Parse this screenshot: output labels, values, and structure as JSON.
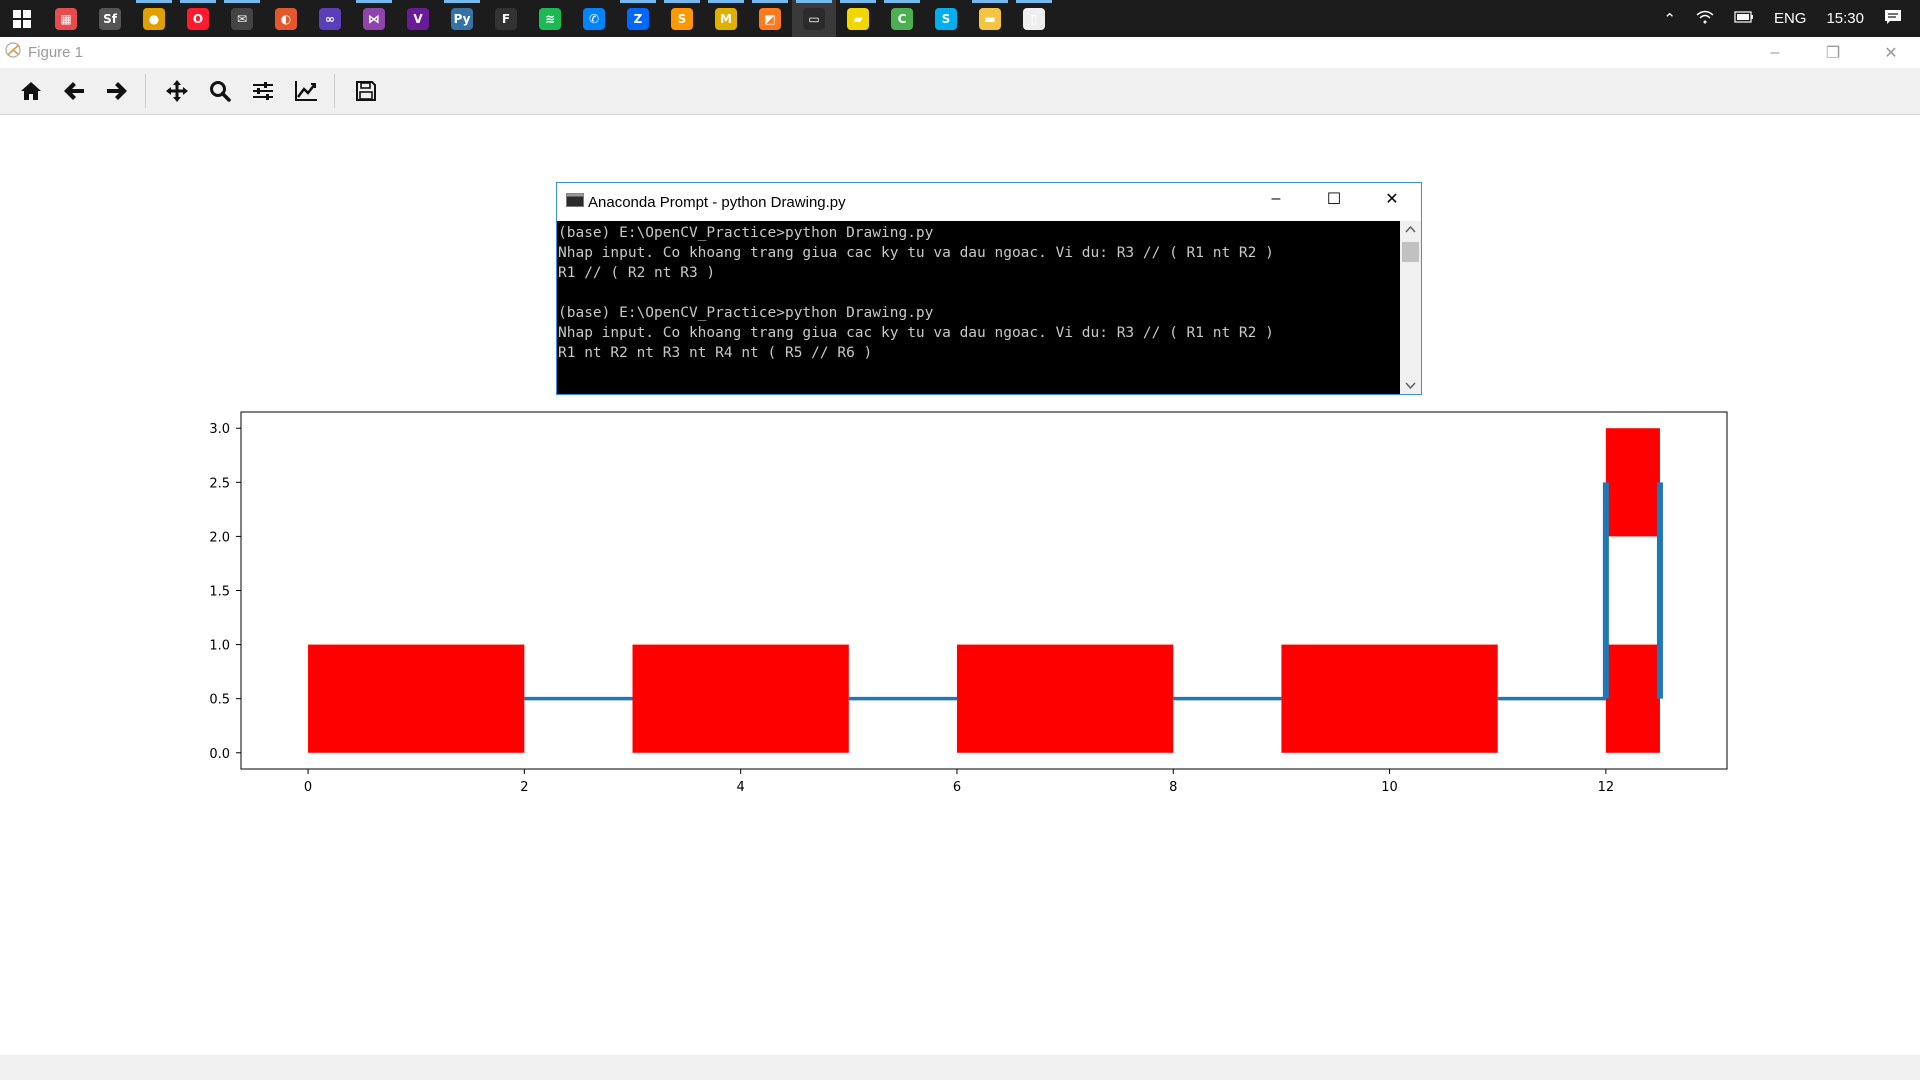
{
  "taskbar": {
    "apps": [
      {
        "name": "windows-start-icon",
        "glyph": "",
        "color": "#ffffff"
      },
      {
        "name": "app-grid-icon",
        "glyph": "▦",
        "color": "#e84b4b"
      },
      {
        "name": "sf-app-icon",
        "glyph": "Sf",
        "color": "#555555"
      },
      {
        "name": "chrome-icon",
        "glyph": "●",
        "color": "#e0a100"
      },
      {
        "name": "opera-icon",
        "glyph": "O",
        "color": "#ff1b2d"
      },
      {
        "name": "mail-icon",
        "glyph": "✉",
        "color": "#444444"
      },
      {
        "name": "paint-app-icon",
        "glyph": "◐",
        "color": "#e2582b"
      },
      {
        "name": "infinity-app-icon",
        "glyph": "∞",
        "color": "#5b3fb8"
      },
      {
        "name": "visual-studio-icon",
        "glyph": "⋈",
        "color": "#8e44ad"
      },
      {
        "name": "visual-studio-2-icon",
        "glyph": "V",
        "color": "#6a1b9a"
      },
      {
        "name": "python-icon",
        "glyph": "Py",
        "color": "#3572a5"
      },
      {
        "name": "fl-studio-icon",
        "glyph": "F",
        "color": "#333333"
      },
      {
        "name": "spotify-icon",
        "glyph": "≋",
        "color": "#1db954"
      },
      {
        "name": "messenger-icon",
        "glyph": "✆",
        "color": "#0084ff"
      },
      {
        "name": "zalo-icon",
        "glyph": "Z",
        "color": "#0068ff"
      },
      {
        "name": "sublime-text-icon",
        "glyph": "S",
        "color": "#ff9800"
      },
      {
        "name": "matlab-icon",
        "glyph": "M",
        "color": "#e0b000"
      },
      {
        "name": "orange-app-icon",
        "glyph": "◩",
        "color": "#ff7a1a"
      },
      {
        "name": "terminal-icon",
        "glyph": "▭",
        "color": "#2b2b2b"
      },
      {
        "name": "sticky-notes-icon",
        "glyph": "▰",
        "color": "#f2d600"
      },
      {
        "name": "camtasia-icon",
        "glyph": "C",
        "color": "#4caf50"
      },
      {
        "name": "skype-icon",
        "glyph": "S",
        "color": "#00aff0"
      },
      {
        "name": "file-explorer-icon",
        "glyph": "▬",
        "color": "#f4c542"
      },
      {
        "name": "notepad-icon",
        "glyph": "▯",
        "color": "#eeeeee"
      }
    ],
    "running": [
      3,
      4,
      5,
      8,
      10,
      14,
      15,
      16,
      17,
      18,
      19,
      20,
      22,
      23
    ],
    "active": 18,
    "tray": {
      "language": "ENG",
      "time": "15:30"
    }
  },
  "figure_window": {
    "title": "Figure 1",
    "controls": [
      "–",
      "❐",
      "✕"
    ]
  },
  "toolbar": {
    "buttons": [
      {
        "name": "home-icon",
        "label": "Home"
      },
      {
        "name": "back-arrow-icon",
        "label": "Back"
      },
      {
        "name": "forward-arrow-icon",
        "label": "Forward"
      },
      {
        "name": "pan-move-icon",
        "label": "Pan"
      },
      {
        "name": "zoom-magnifier-icon",
        "label": "Zoom"
      },
      {
        "name": "configure-subplots-icon",
        "label": "Subplots"
      },
      {
        "name": "edit-axis-icon",
        "label": "Customize"
      },
      {
        "name": "save-floppy-icon",
        "label": "Save"
      }
    ]
  },
  "prompt_window": {
    "title": "Anaconda Prompt - python  Drawing.py",
    "controls": [
      "–",
      "☐",
      "✕"
    ],
    "lines": [
      "(base) E:\\OpenCV_Practice>python Drawing.py",
      "Nhap input. Co khoang trang giua cac ky tu va dau ngoac. Vi du: R3 // ( R1 nt R2 )",
      "R1 // ( R2 nt R3 )",
      "",
      "(base) E:\\OpenCV_Practice>python Drawing.py",
      "Nhap input. Co khoang trang giua cac ky tu va dau ngoac. Vi du: R3 // ( R1 nt R2 )",
      "R1 nt R2 nt R3 nt R4 nt ( R5 // R6 )"
    ]
  },
  "chart_data": {
    "type": "bar",
    "title": "",
    "xlabel": "",
    "ylabel": "",
    "xlim": [
      -0.62,
      13.12
    ],
    "ylim": [
      -0.15,
      3.15
    ],
    "xticks": [
      0,
      2,
      4,
      6,
      8,
      10,
      12
    ],
    "yticks": [
      0.0,
      0.5,
      1.0,
      1.5,
      2.0,
      2.5,
      3.0
    ],
    "ytick_labels": [
      "0.0",
      "0.5",
      "1.0",
      "1.5",
      "2.0",
      "2.5",
      "3.0"
    ],
    "grid": false,
    "rect_color": "#ff0000",
    "line_color": "#1f77b4",
    "rectangles": [
      {
        "x0": 0,
        "x1": 2,
        "y0": 0,
        "y1": 1
      },
      {
        "x0": 3,
        "x1": 5,
        "y0": 0,
        "y1": 1
      },
      {
        "x0": 6,
        "x1": 8,
        "y0": 0,
        "y1": 1
      },
      {
        "x0": 9,
        "x1": 11,
        "y0": 0,
        "y1": 1
      },
      {
        "x0": 12,
        "x1": 12.5,
        "y0": 0,
        "y1": 1
      },
      {
        "x0": 12,
        "x1": 12.5,
        "y0": 2,
        "y1": 3
      }
    ],
    "lines": [
      {
        "x": [
          2,
          3
        ],
        "y": [
          0.5,
          0.5
        ],
        "width": "thin"
      },
      {
        "x": [
          5,
          6
        ],
        "y": [
          0.5,
          0.5
        ],
        "width": "thin"
      },
      {
        "x": [
          8,
          9
        ],
        "y": [
          0.5,
          0.5
        ],
        "width": "thin"
      },
      {
        "x": [
          11,
          12
        ],
        "y": [
          0.5,
          0.5
        ],
        "width": "thin"
      },
      {
        "x": [
          12,
          12
        ],
        "y": [
          0.5,
          2.5
        ],
        "width": "thick"
      },
      {
        "x": [
          12.5,
          12.5
        ],
        "y": [
          0.5,
          2.5
        ],
        "width": "thick"
      }
    ]
  }
}
